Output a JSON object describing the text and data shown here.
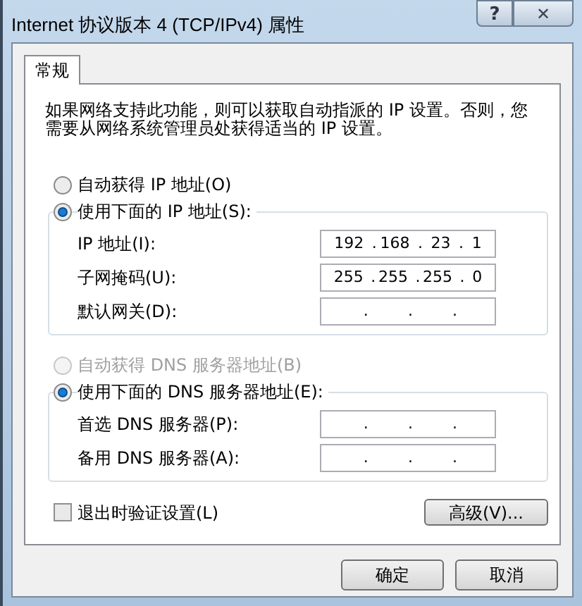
{
  "window": {
    "title": "Internet 协议版本 4 (TCP/IPv4) 属性",
    "help": "?",
    "close": "✕"
  },
  "tabs": [
    {
      "label": "常规",
      "selected": true
    }
  ],
  "intro": "如果网络支持此功能，则可以获取自动指派的 IP 设置。否则，您需要从网络系统管理员处获得适当的 IP 设置。",
  "ip_section": {
    "radios": [
      {
        "label": "自动获得 IP 地址(O)",
        "selected": false,
        "disabled": false
      },
      {
        "label": "使用下面的 IP 地址(S):",
        "selected": true,
        "disabled": false
      }
    ],
    "fields": [
      {
        "label": "IP 地址(I):",
        "value": "192 .168 . 23 . 1"
      },
      {
        "label": "子网掩码(U):",
        "value": "255 .255 .255 . 0"
      },
      {
        "label": "默认网关(D):",
        "value": " . . ."
      }
    ]
  },
  "dns_section": {
    "radios": [
      {
        "label": "自动获得 DNS 服务器地址(B)",
        "selected": false,
        "disabled": true
      },
      {
        "label": "使用下面的 DNS 服务器地址(E):",
        "selected": true,
        "disabled": false
      }
    ],
    "fields": [
      {
        "label": "首选 DNS 服务器(P):",
        "value": " . . ."
      },
      {
        "label": "备用 DNS 服务器(A):",
        "value": " . . ."
      }
    ]
  },
  "validate_checkbox": {
    "label": "退出时验证设置(L)",
    "checked": false
  },
  "advanced_button": "高级(V)...",
  "buttons": [
    "确定",
    "取消"
  ]
}
